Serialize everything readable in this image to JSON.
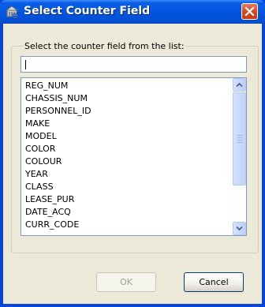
{
  "window": {
    "title": "Select Counter Field",
    "title_icon": "database-icon",
    "close_icon": "close-icon"
  },
  "group": {
    "label": "Select the counter field from the list:"
  },
  "search": {
    "value": ""
  },
  "list": {
    "items": [
      "REG_NUM",
      "CHASSIS_NUM",
      "PERSONNEL_ID",
      "MAKE",
      "MODEL",
      "COLOR",
      "COLOUR",
      "YEAR",
      "CLASS",
      "LEASE_PUR",
      "DATE_ACQ",
      "CURR_CODE"
    ]
  },
  "buttons": {
    "ok_label": "OK",
    "cancel_label": "Cancel"
  },
  "colors": {
    "titlebar": "#0356e0",
    "client_background": "#ece9d8",
    "close_button": "#d9461f",
    "field_border": "#7f9db9"
  }
}
